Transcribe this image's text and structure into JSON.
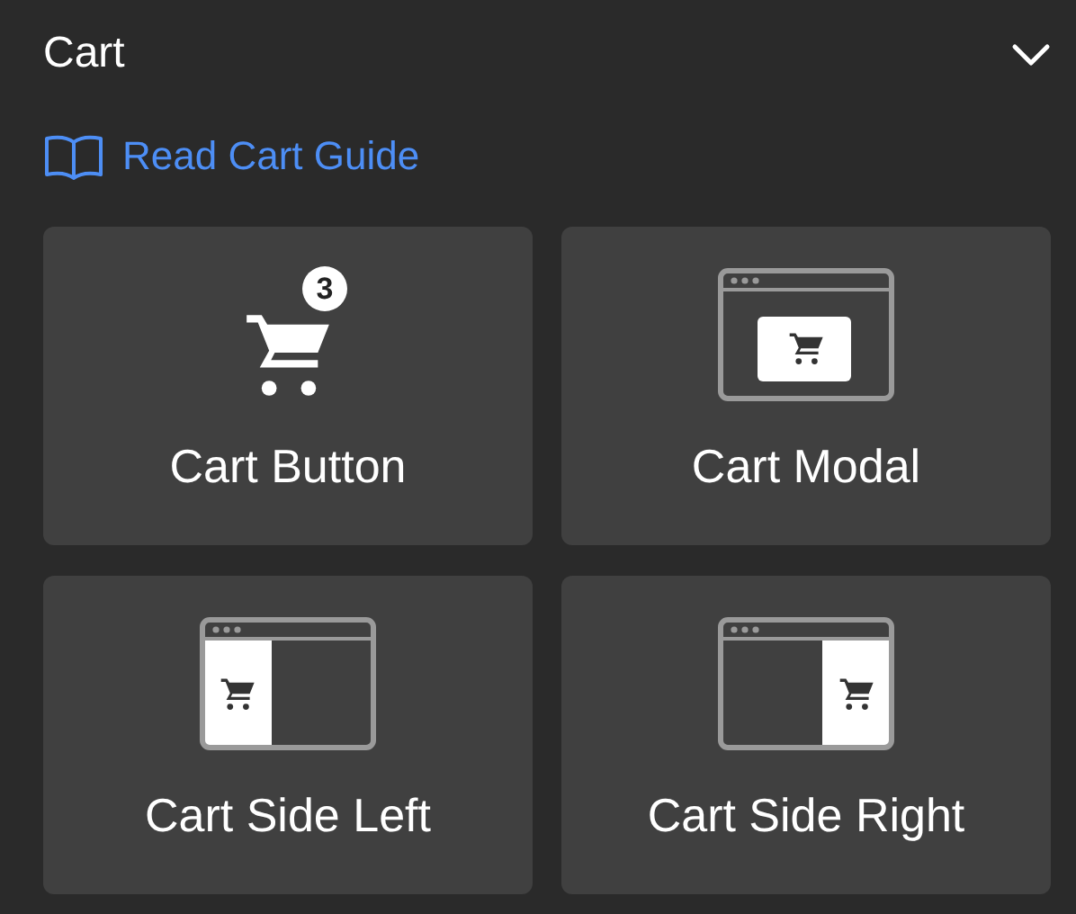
{
  "section": {
    "title": "Cart",
    "expanded": true
  },
  "guide_link": {
    "label": "Read Cart Guide"
  },
  "cards": [
    {
      "kind": "button",
      "label": "Cart Button",
      "badge": "3"
    },
    {
      "kind": "modal",
      "label": "Cart Modal"
    },
    {
      "kind": "side-left",
      "label": "Cart Side Left"
    },
    {
      "kind": "side-right",
      "label": "Cart Side Right"
    }
  ]
}
